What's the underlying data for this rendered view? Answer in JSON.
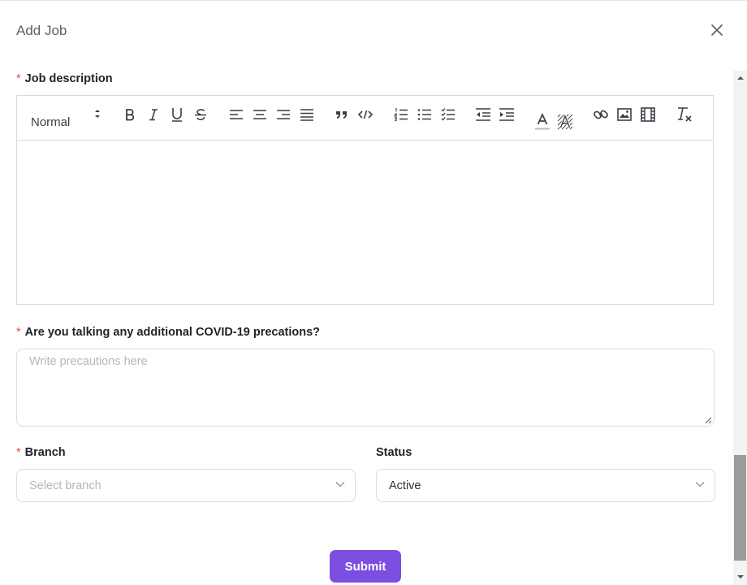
{
  "modal": {
    "title": "Add Job"
  },
  "job_description": {
    "required_mark": "*",
    "label": "Job description",
    "toolbar": {
      "heading_select": "Normal",
      "buttons": [
        "bold-icon",
        "italic-icon",
        "underline-icon",
        "strikethrough-icon",
        "align-left-icon",
        "align-center-icon",
        "align-right-icon",
        "align-justify-icon",
        "blockquote-icon",
        "code-icon",
        "ordered-list-icon",
        "bullet-list-icon",
        "checklist-icon",
        "outdent-icon",
        "indent-icon",
        "text-color-icon",
        "background-color-icon",
        "link-icon",
        "image-icon",
        "video-icon",
        "clear-format-icon"
      ]
    }
  },
  "covid": {
    "required_mark": "*",
    "label": "Are you talking any additional COVID-19 precations?",
    "placeholder": "Write precautions here"
  },
  "branch": {
    "required_mark": "*",
    "label": "Branch",
    "placeholder": "Select branch"
  },
  "status": {
    "label": "Status",
    "value": "Active"
  },
  "submit": {
    "label": "Submit"
  },
  "colors": {
    "accent": "#7b4ee0",
    "required": "#e5484d"
  }
}
